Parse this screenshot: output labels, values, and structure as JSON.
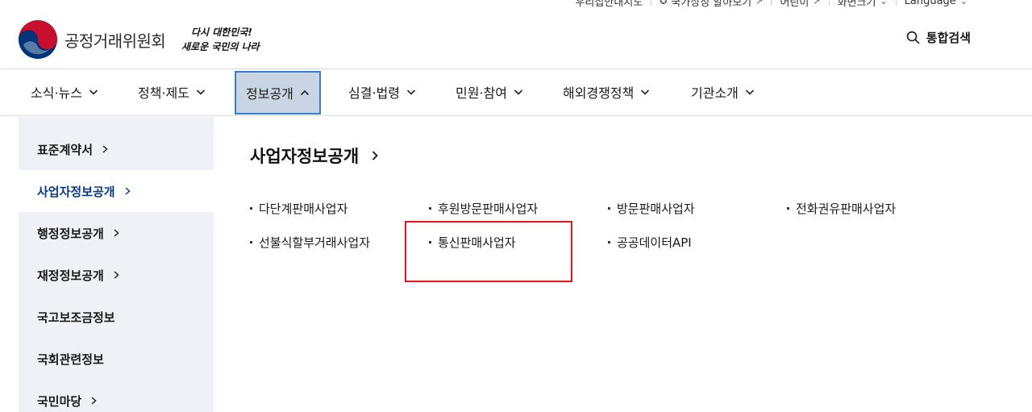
{
  "utility": {
    "items": [
      "우리집안내지도",
      "국가상징 알아보기",
      "어린이",
      "화면크기",
      "Language"
    ]
  },
  "header": {
    "org_name": "공정거래위원회",
    "slogan_line1": "다시 대한민국!",
    "slogan_line2": "새로운 국민의 나라",
    "search_label": "통합검색"
  },
  "gnb": {
    "items": [
      "소식·뉴스",
      "정책·제도",
      "정보공개",
      "심결·법령",
      "민원·참여",
      "해외경쟁정책",
      "기관소개"
    ],
    "active_index": 2
  },
  "sidebar": {
    "items": [
      "표준계약서",
      "사업자정보공개",
      "행정정보공개",
      "재정정보공개",
      "국고보조금정보",
      "국회관련정보",
      "국민마당"
    ],
    "active_index": 1
  },
  "content": {
    "title": "사업자정보공개",
    "links": [
      "다단계판매사업자",
      "후원방문판매사업자",
      "방문판매사업자",
      "전화권유판매사업자",
      "선불식할부거래사업자",
      "통신판매사업자",
      "공공데이터API"
    ]
  },
  "colors": {
    "active_nav_bg": "#c9d5e3",
    "active_nav_border": "#3a7bd5",
    "sidebar_bg": "#eef1f5",
    "sidebar_active_text": "#0b3a86",
    "highlight_border": "#e8141c",
    "emblem_red": "#c8102e",
    "emblem_blue": "#003478"
  }
}
